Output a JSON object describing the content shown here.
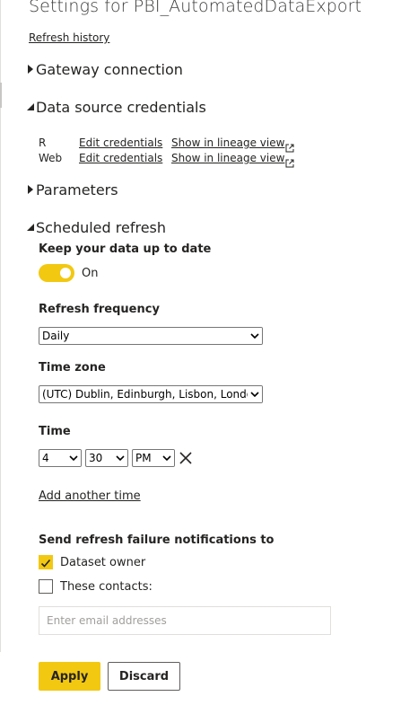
{
  "page": {
    "title": "Settings for PBI_AutomatedDataExport",
    "refresh_history_link": "Refresh history"
  },
  "sections": {
    "gateway": {
      "label": "Gateway connection",
      "expanded": false,
      "caret_icon": "caret-right-icon"
    },
    "credentials": {
      "label": "Data source credentials",
      "expanded": true,
      "caret_icon": "caret-down-icon",
      "rows": [
        {
          "type": "R",
          "edit_label": "Edit credentials",
          "lineage_label": "Show in lineage view"
        },
        {
          "type": "Web",
          "edit_label": "Edit credentials",
          "lineage_label": "Show in lineage view"
        }
      ]
    },
    "parameters": {
      "label": "Parameters",
      "expanded": false,
      "caret_icon": "caret-right-icon"
    },
    "scheduled_refresh": {
      "label": "Scheduled refresh",
      "expanded": true,
      "caret_icon": "caret-down-icon",
      "keep_up_to_date_label": "Keep your data up to date",
      "toggle_state_label": "On",
      "frequency_label": "Refresh frequency",
      "frequency_value": "Daily",
      "timezone_label": "Time zone",
      "timezone_value": "(UTC) Dublin, Edinburgh, Lisbon, London",
      "time_label": "Time",
      "time_hour": "4",
      "time_minute": "30",
      "time_period": "PM",
      "add_time_link": "Add another time",
      "notify_label": "Send refresh failure notifications to",
      "dataset_owner_label": "Dataset owner",
      "dataset_owner_checked": true,
      "contacts_label": "These contacts:",
      "contacts_checked": false,
      "email_placeholder": "Enter email addresses"
    }
  },
  "actions": {
    "apply_label": "Apply",
    "discard_label": "Discard"
  },
  "colors": {
    "accent": "#f2c811",
    "text": "#252423",
    "muted_text": "#a19f9d",
    "border": "#605e5c"
  }
}
